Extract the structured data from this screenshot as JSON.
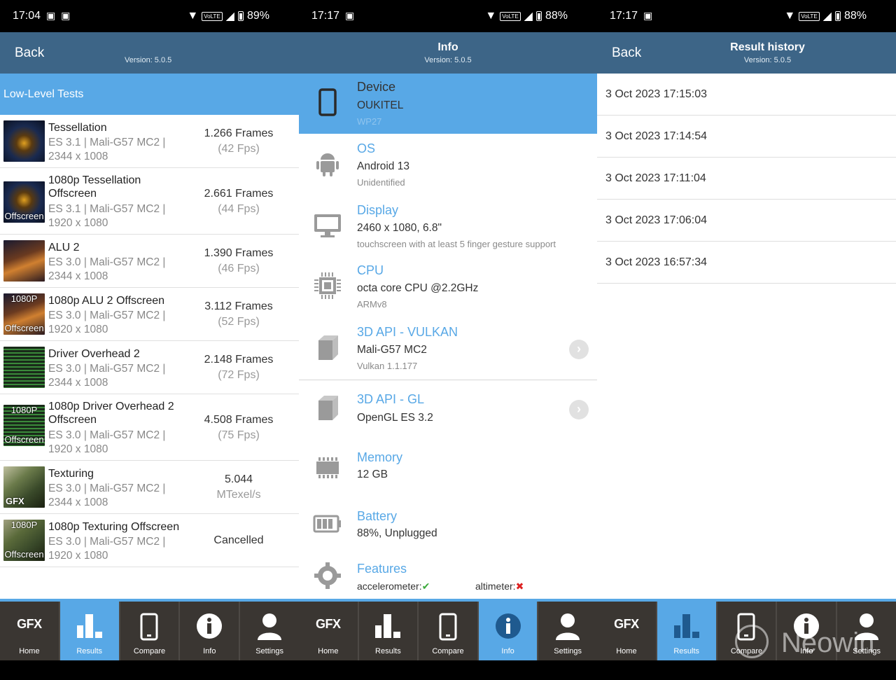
{
  "panels": {
    "results": {
      "status": {
        "time": "17:04",
        "battery": "89%",
        "volte": "VoLTE"
      },
      "appbar": {
        "back": "Back",
        "version": "Version: 5.0.5"
      },
      "section": "Low-Level Tests",
      "tests": [
        {
          "name": "Tessellation",
          "sub1": "ES 3.1 | Mali-G57 MC2 |",
          "sub2": "2344 x 1008",
          "res1": "1.266 Frames",
          "res2": "(42 Fps)",
          "label": ""
        },
        {
          "name": "1080p Tessellation",
          "name2": "Offscreen",
          "sub1": "ES 3.1 | Mali-G57 MC2 |",
          "sub2": "1920 x 1080",
          "res1": "2.661 Frames",
          "res2": "(44 Fps)",
          "label": "Offscreen"
        },
        {
          "name": "ALU 2",
          "sub1": "ES 3.0 | Mali-G57 MC2 |",
          "sub2": "2344 x 1008",
          "res1": "1.390 Frames",
          "res2": "(46 Fps)",
          "label": ""
        },
        {
          "name": "1080p ALU 2 Offscreen",
          "sub1": "ES 3.0 | Mali-G57 MC2 |",
          "sub2": "1920 x 1080",
          "res1": "3.112 Frames",
          "res2": "(52 Fps)",
          "label": "Offscreen",
          "label_top": "1080P"
        },
        {
          "name": "Driver Overhead 2",
          "sub1": "ES 3.0 | Mali-G57 MC2 |",
          "sub2": "2344 x 1008",
          "res1": "2.148 Frames",
          "res2": "(72 Fps)",
          "label": ""
        },
        {
          "name": "1080p Driver Overhead 2",
          "name2": "Offscreen",
          "sub1": "ES 3.0 | Mali-G57 MC2 |",
          "sub2": "1920 x 1080",
          "res1": "4.508 Frames",
          "res2": "(75 Fps)",
          "label": "Offscreen",
          "label_top": "1080P"
        },
        {
          "name": "Texturing",
          "sub1": "ES 3.0 | Mali-G57 MC2 |",
          "sub2": "2344 x 1008",
          "res1": "5.044",
          "res2": "MTexel/s",
          "label": "",
          "label_bl": "GFX"
        },
        {
          "name": "1080p Texturing Offscreen",
          "sub1": "ES 3.0 | Mali-G57 MC2 |",
          "sub2": "1920 x 1080",
          "res1": "Cancelled",
          "res2": "",
          "label": "Offscreen",
          "label_top": "1080P"
        }
      ]
    },
    "info": {
      "status": {
        "time": "17:17",
        "battery": "88%",
        "volte": "VoLTE"
      },
      "appbar": {
        "title": "Info",
        "version": "Version: 5.0.5"
      },
      "rows": [
        {
          "title": "Device",
          "v1": "OUKITEL",
          "v2": "WP27",
          "icon": "phone-icon"
        },
        {
          "title": "OS",
          "v1": "Android 13",
          "v2": "Unidentified",
          "icon": "android-icon"
        },
        {
          "title": "Display",
          "v1": "2460 x 1080, 6.8\"",
          "v2": "touchscreen with at least 5 finger gesture support",
          "icon": "monitor-icon"
        },
        {
          "title": "CPU",
          "v1": "octa core CPU @2.2GHz",
          "v2": "ARMv8",
          "icon": "cpu-icon"
        },
        {
          "title": "3D API - VULKAN",
          "v1": "Mali-G57 MC2",
          "v2": "Vulkan 1.1.177",
          "icon": "cube-icon"
        },
        {
          "title": "3D API - GL",
          "v1": "OpenGL ES 3.2",
          "v2": "",
          "icon": "cube-icon"
        },
        {
          "title": "Memory",
          "v1": "12 GB",
          "v2": "",
          "icon": "memory-icon"
        },
        {
          "title": "Battery",
          "v1": "88%, Unplugged",
          "v2": "",
          "icon": "battery-icon"
        },
        {
          "title": "Features",
          "f1": "accelerometer:",
          "f1_mark": "✔",
          "f2": "altimeter:",
          "f2_mark": "✖",
          "icon": "gear-icon"
        }
      ]
    },
    "history": {
      "status": {
        "time": "17:17",
        "battery": "88%",
        "volte": "VoLTE"
      },
      "appbar": {
        "back": "Back",
        "title": "Result history",
        "version": "Version: 5.0.5"
      },
      "entries": [
        "3 Oct 2023 17:15:03",
        "3 Oct 2023 17:14:54",
        "3 Oct 2023 17:11:04",
        "3 Oct 2023 17:06:04",
        "3 Oct 2023 16:57:34"
      ]
    }
  },
  "tabs": {
    "home": "Home",
    "results": "Results",
    "compare": "Compare",
    "info": "Info",
    "settings": "Settings",
    "gfx": "GFX"
  },
  "watermark": "Neowin",
  "colors": {
    "accent": "#58a8e6",
    "appbar": "#3d6587",
    "tabbar": "#3a3632"
  }
}
